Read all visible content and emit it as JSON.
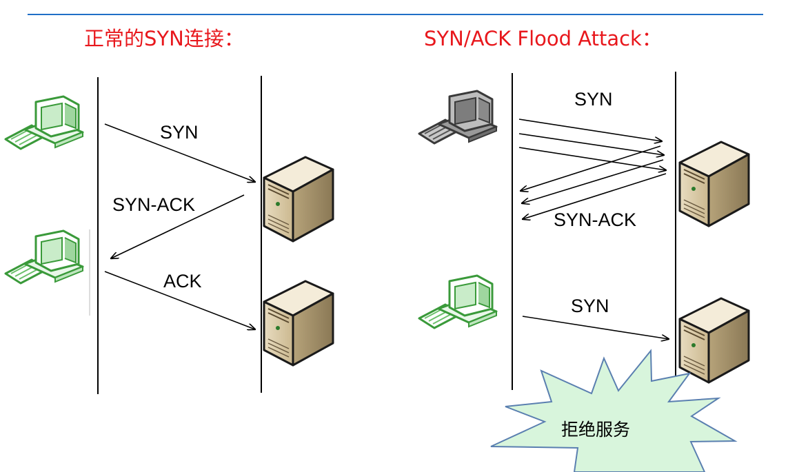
{
  "slide": {
    "header_rule_color": "#1f6fc6",
    "title_color": "#e8171c"
  },
  "left_panel": {
    "title": "正常的SYN连接：",
    "messages": {
      "syn": "SYN",
      "syn_ack": "SYN-ACK",
      "ack": "ACK"
    }
  },
  "right_panel": {
    "title": "SYN/ACK Flood Attack：",
    "messages": {
      "syn_flood": "SYN",
      "syn_ack_flood": "SYN-ACK",
      "syn_legit": "SYN"
    },
    "callout": {
      "text": "拒绝服务",
      "fill": "#d8f5dc"
    }
  },
  "icons": {
    "client_legit": "green-desktop-computer-icon",
    "client_attacker": "gray-desktop-computer-icon",
    "server": "tower-server-icon"
  }
}
